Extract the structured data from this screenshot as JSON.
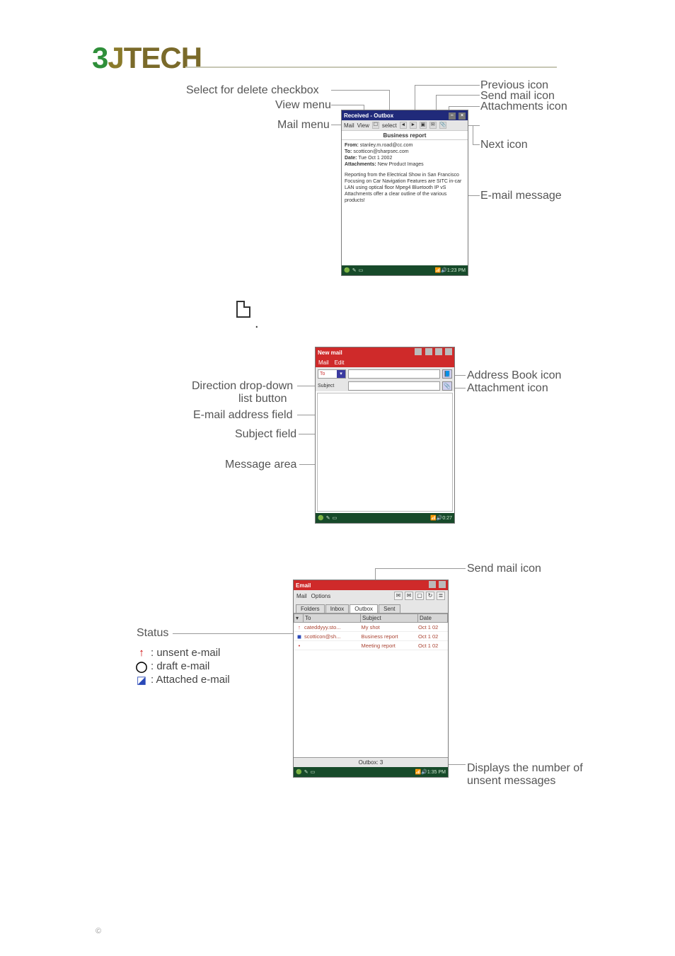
{
  "logo": {
    "three": "3",
    "j": "J",
    "tech": "TECH"
  },
  "callouts": {
    "select_delete": "Select for delete checkbox",
    "view_menu": "View menu",
    "mail_menu": "Mail menu",
    "previous_icon": "Previous icon",
    "send_mail_icon": "Send mail icon",
    "attachments_icon": "Attachments icon",
    "next_icon": "Next icon",
    "email_message": "E-mail message",
    "direction_dropdown": "Direction drop-down",
    "list_button": "list button",
    "email_field": "E-mail address field",
    "subject_field": "Subject field",
    "message_area": "Message area",
    "address_book_icon": "Address Book icon",
    "attachment_icon": "Attachment icon",
    "send_mail_icon2": "Send mail icon",
    "status": "Status",
    "outbox_count_a": "Displays the number of",
    "outbox_count_b": "unsent messages"
  },
  "panel1": {
    "title": "Received - Outbox",
    "menu_mail": "Mail",
    "menu_view": "View",
    "checkbox_label": "select",
    "subject": "Business report",
    "hdr_from_label": "From:",
    "hdr_from": "stanley.m.road@cc.com",
    "hdr_to_label": "To:",
    "hdr_to": "scotticon@sharpsec.com",
    "hdr_date_label": "Date:",
    "hdr_date": "Tue Oct 1 2002",
    "hdr_att_label": "Attachments:",
    "hdr_att": "New Product Images",
    "body": "Reporting from the Electrical Show in San Francisco Focusing on Car Navigation Features are SITC in-car LAN using optical floor Mpeg4 Bluetooth IP vS Attachments offer a clear outline of the various products!",
    "task_time": "1:23 PM"
  },
  "panel2": {
    "title": "New mail",
    "menu_mail": "Mail",
    "menu_edit": "Edit",
    "to_label": "To",
    "subject_label": "Subject",
    "task_time": "0:27"
  },
  "panel3": {
    "title": "Email",
    "menu_mail": "Mail",
    "menu_options": "Options",
    "tabs": {
      "folders": "Folders",
      "inbox": "Inbox",
      "outbox": "Outbox",
      "sent": "Sent"
    },
    "cols": {
      "status": "",
      "to": "To",
      "subject": "Subject",
      "date": "Date"
    },
    "rows": [
      {
        "icon": "↑",
        "to": "cateddyyy.sto...",
        "subject": "My shot",
        "date": "Oct 1 02"
      },
      {
        "icon": "◼",
        "to": "scotticon@sh...",
        "subject": "Business report",
        "date": "Oct 1 02"
      },
      {
        "icon": "•",
        "to": "",
        "subject": "Meeting report",
        "date": "Oct 1 02"
      }
    ],
    "statusline": "Outbox: 3",
    "task_time": "1:35 PM"
  },
  "legend": {
    "unsent": ": unsent e-mail",
    "draft": ": draft e-mail",
    "attached": ": Attached e-mail"
  },
  "copyright": "©"
}
